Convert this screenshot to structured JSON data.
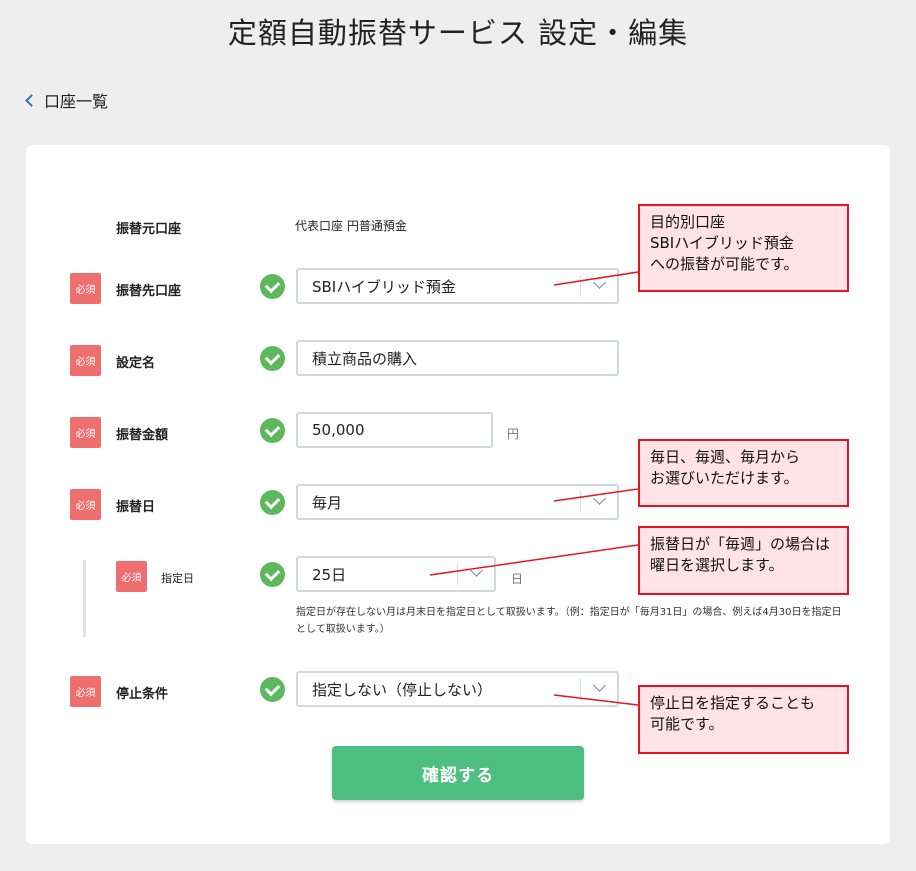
{
  "page": {
    "title": "定額自動振替サービス 設定・編集"
  },
  "nav": {
    "back_label": "口座一覧"
  },
  "form": {
    "required_badge": "必須",
    "source": {
      "label": "振替元口座",
      "value": "代表口座 円普通預金"
    },
    "destination": {
      "label": "振替先口座",
      "value": "SBIハイブリッド預金"
    },
    "setting_name": {
      "label": "設定名",
      "value": "積立商品の購入"
    },
    "amount": {
      "label": "振替金額",
      "value": "50,000",
      "unit": "円"
    },
    "transfer_day": {
      "label": "振替日",
      "value": "毎月"
    },
    "specified_day": {
      "label": "指定日",
      "value": "25日",
      "unit": "日",
      "note": "指定日が存在しない月は月末日を指定日として取扱います。（例：指定日が「毎月31日」の場合、例えば4月30日を指定日として取扱います。）"
    },
    "stop_condition": {
      "label": "停止条件",
      "value": "指定しない（停止しない）"
    },
    "submit_label": "確認する"
  },
  "callouts": {
    "destination": "目的別口座\nSBIハイブリッド預金\nへの振替が可能です。",
    "frequency": "毎日、毎週、毎月から\nお選びいただけます。",
    "weekly": "振替日が「毎週」の場合は\n曜日を選択します。",
    "stop": "停止日を指定することも\n可能です。"
  },
  "colors": {
    "accent": "#4dbf80",
    "required": "#ef6f6f",
    "callout_border": "#e8141f",
    "callout_bg": "#ffe3e6"
  }
}
